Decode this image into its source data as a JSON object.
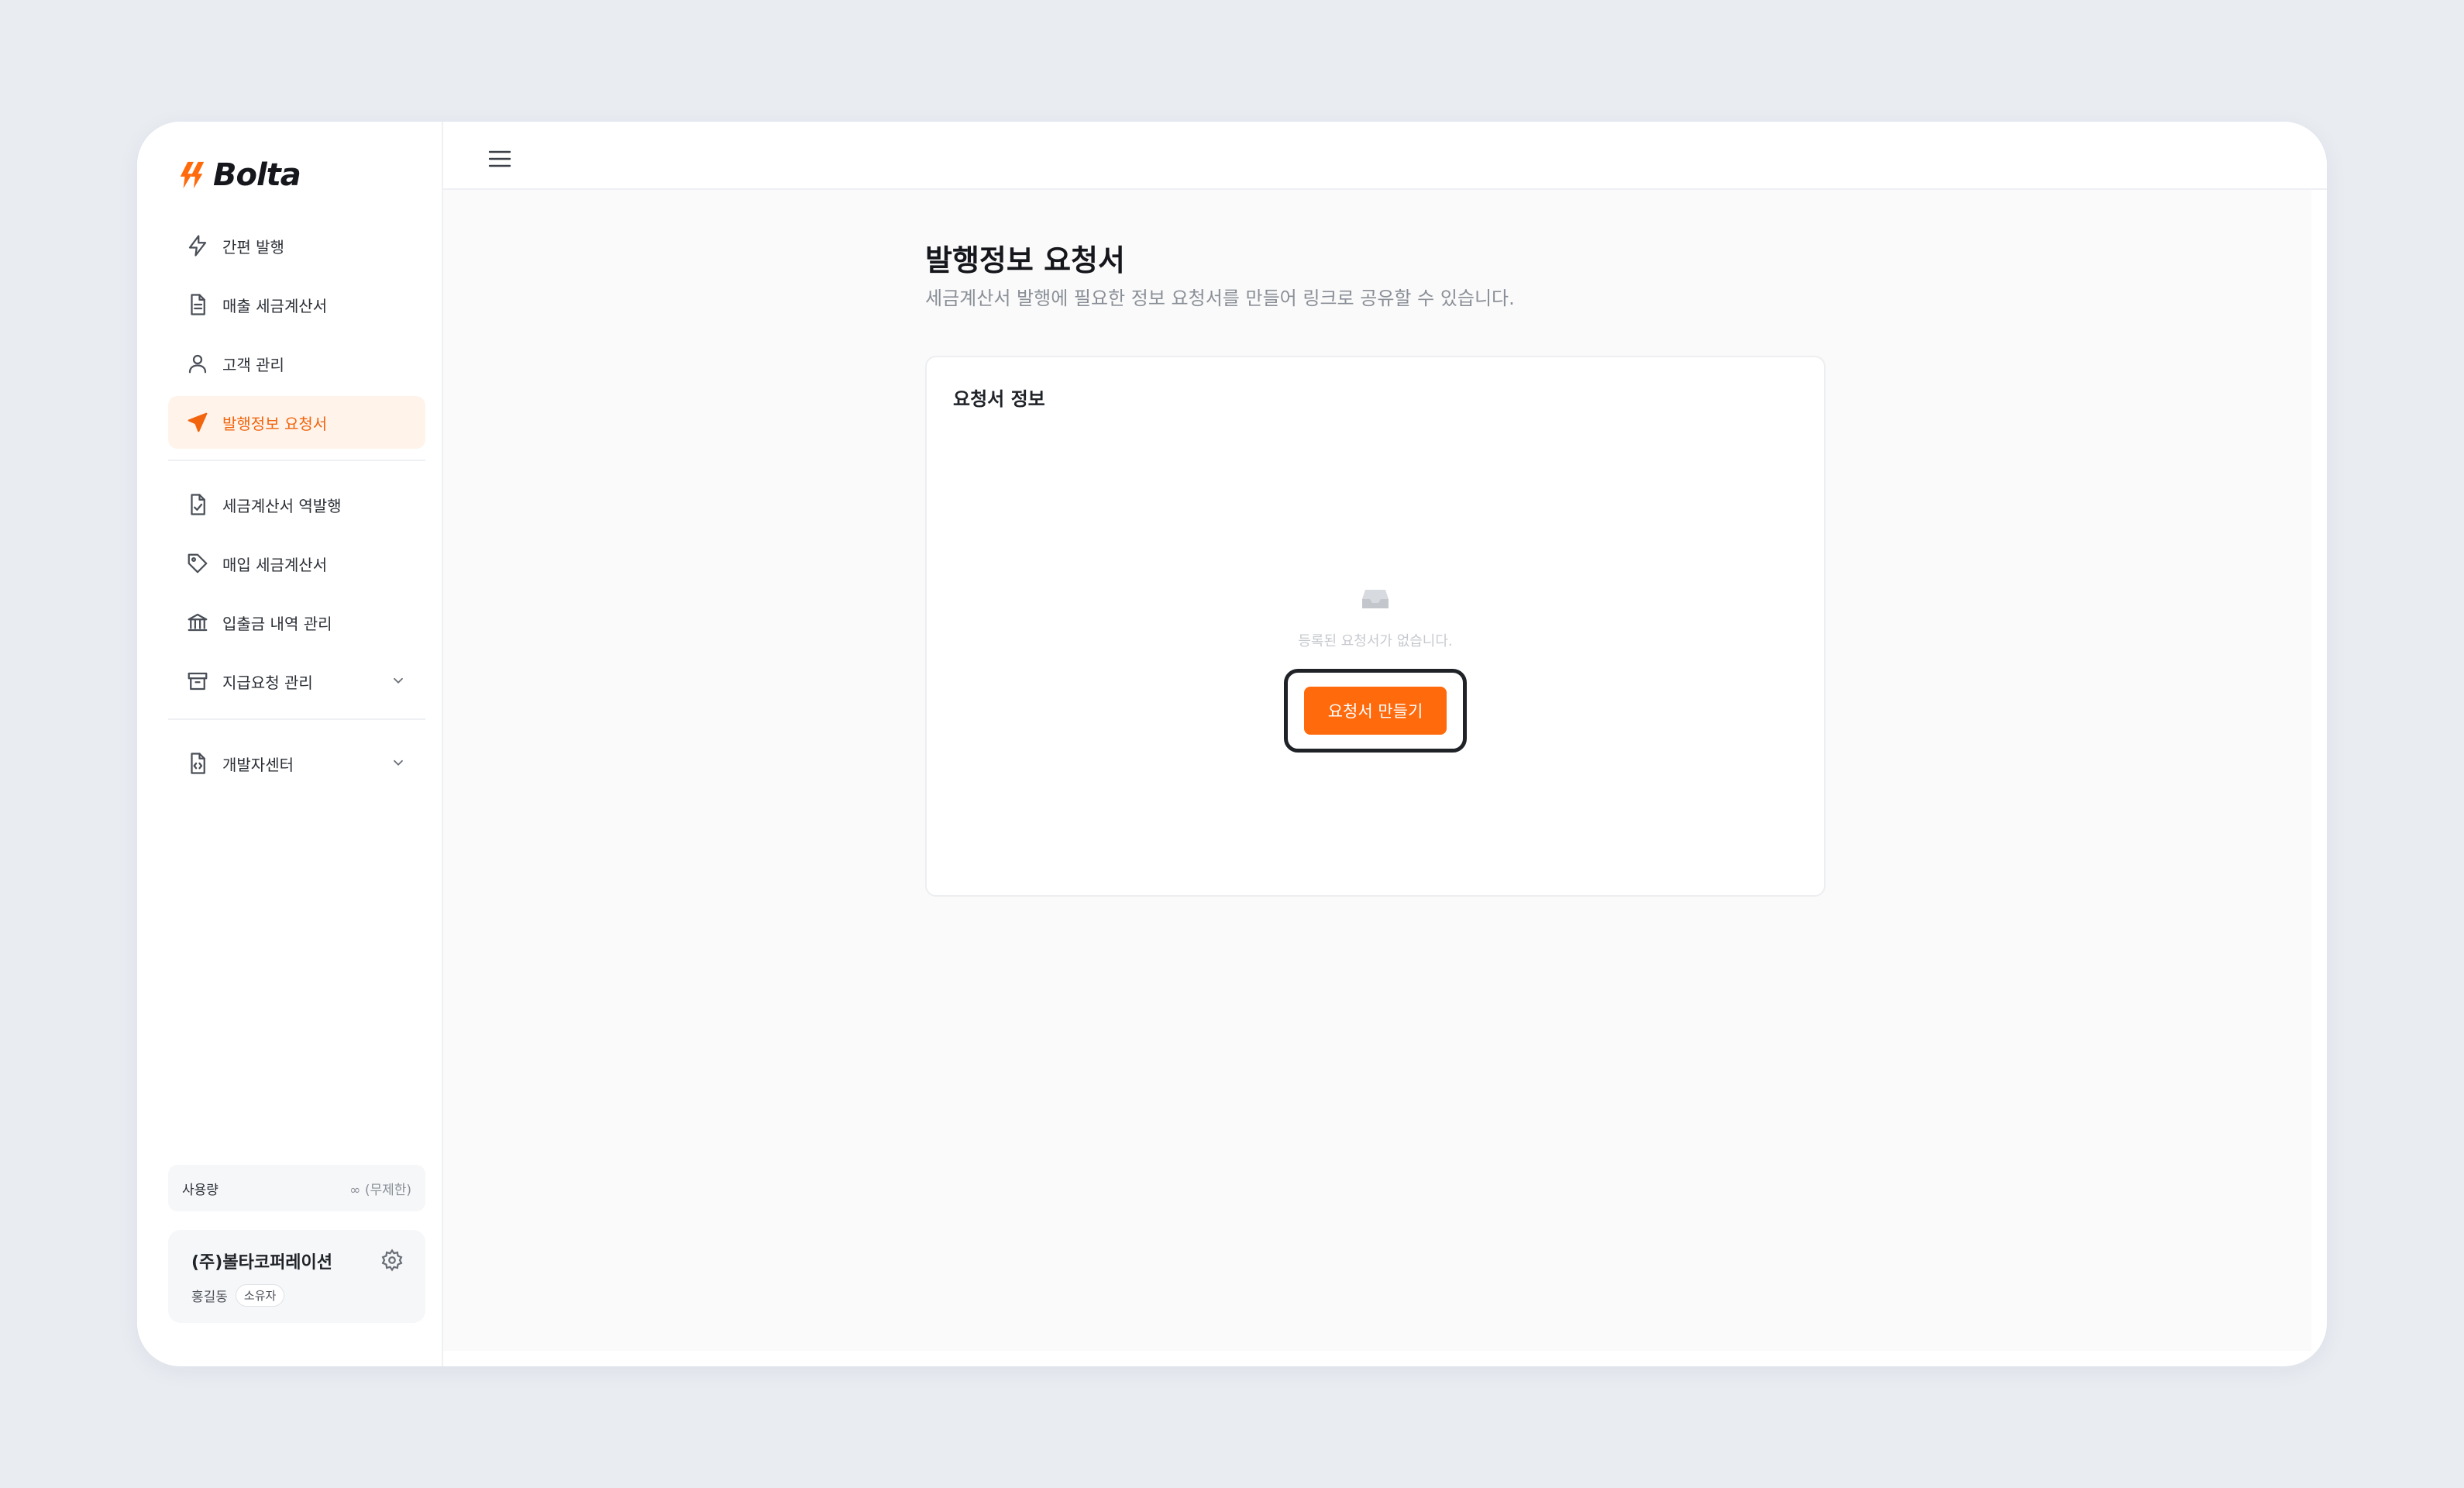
{
  "brand": {
    "name": "Bolta",
    "accent": "#ff6a0d"
  },
  "sidebar": {
    "items": [
      {
        "label": "간편 발행",
        "icon": "lightning-icon"
      },
      {
        "label": "매출 세금계산서",
        "icon": "document-icon"
      },
      {
        "label": "고객 관리",
        "icon": "person-icon"
      },
      {
        "label": "발행정보 요청서",
        "icon": "send-icon",
        "active": true
      },
      {
        "label": "세금계산서 역발행",
        "icon": "document-check-icon"
      },
      {
        "label": "매입 세금계산서",
        "icon": "tag-icon"
      },
      {
        "label": "입출금 내역 관리",
        "icon": "bank-icon"
      },
      {
        "label": "지급요청 관리",
        "icon": "archive-icon"
      },
      {
        "label": "개발자센터",
        "icon": "code-document-icon"
      }
    ],
    "usage": {
      "label": "사용량",
      "value": "∞ (무제한)"
    },
    "company": {
      "name": "(주)볼타코퍼레이션",
      "user": "홍길동",
      "role": "소유자"
    }
  },
  "main": {
    "title": "발행정보 요청서",
    "subtitle": "세금계산서 발행에 필요한 정보 요청서를 만들어 링크로 공유할 수 있습니다.",
    "card": {
      "title": "요청서 정보",
      "empty_text": "등록된 요청서가 없습니다.",
      "create_label": "요청서 만들기"
    }
  }
}
